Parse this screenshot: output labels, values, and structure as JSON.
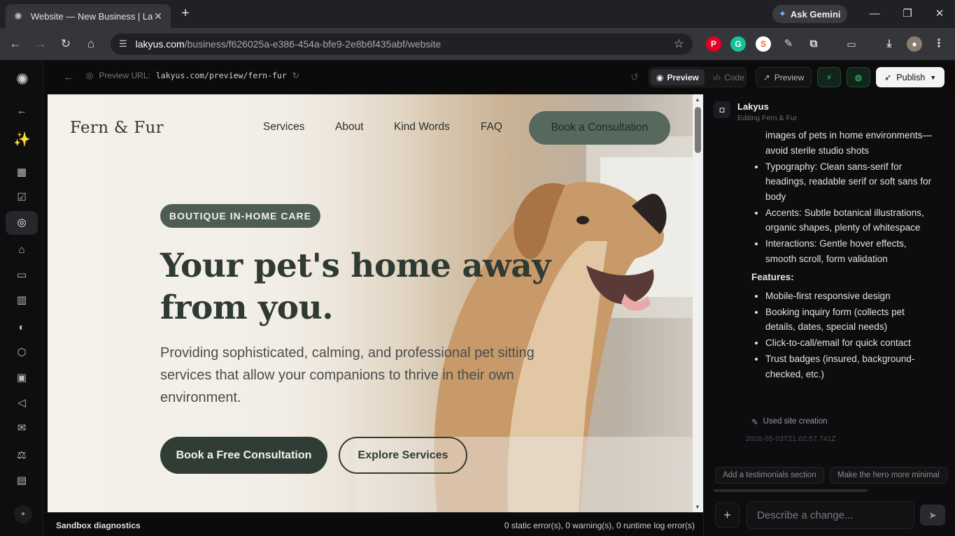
{
  "browser": {
    "tab_title": "Website — New Business | Laky",
    "ask_gemini": "Ask Gemini",
    "url_host": "lakyus.com",
    "url_path": "/business/f626025a-e386-454a-bfe9-2e8b6f435abf/website"
  },
  "toolbar": {
    "preview_url_label": "Preview URL:",
    "preview_url": "lakyus.com/preview/fern-fur",
    "seg_preview": "Preview",
    "seg_code": "Code",
    "preview_button": "Preview",
    "publish": "Publish"
  },
  "site": {
    "logo": "Fern & Fur",
    "nav": [
      "Services",
      "About",
      "Kind Words",
      "FAQ"
    ],
    "cta": "Book a Consultation",
    "badge": "BOUTIQUE IN-HOME CARE",
    "headline": "Your pet's home away from you.",
    "subtext": "Providing sophisticated, calming, and professional pet sitting services that allow your companions to thrive in their own environment.",
    "primary_button": "Book a Free Consultation",
    "secondary_button": "Explore Services"
  },
  "diagnostics": {
    "label": "Sandbox diagnostics",
    "status": "0 static error(s), 0 warning(s), 0 runtime log error(s)"
  },
  "chat": {
    "title": "Lakyus",
    "subtitle": "Editing Fern & Fur",
    "bullets_top": [
      "images of pets in home environments—avoid sterile studio shots",
      "Typography: Clean sans-serif for headings, readable serif or soft sans for body",
      "Accents: Subtle botanical illustrations, organic shapes, plenty of whitespace",
      "Interactions: Gentle hover effects, smooth scroll, form validation"
    ],
    "features_heading": "Features:",
    "features": [
      "Mobile-first responsive design",
      "Booking inquiry form (collects pet details, dates, special needs)",
      "Click-to-call/email for quick contact",
      "Trust badges (insured, background-checked, etc.)"
    ],
    "tool_used": "Used site creation",
    "timestamp": "2026-05-03T21:02:57.741Z",
    "suggestions": [
      "Add a testimonials section",
      "Make the hero more minimal"
    ],
    "input_placeholder": "Describe a change..."
  },
  "icons": {
    "rail": [
      "back-arrow-icon",
      "sparkle-icon",
      "dashboard-grid-icon",
      "checklist-icon",
      "globe-icon",
      "bank-icon",
      "card-icon",
      "bar-chart-icon",
      "palette-icon",
      "box-icon",
      "contact-icon",
      "megaphone-icon",
      "mail-icon",
      "scale-icon",
      "clipboard-icon"
    ]
  },
  "colors": {
    "brand_green": "#2f3d34",
    "badge_green": "#4e5d52",
    "cta_green": "#56695c"
  }
}
